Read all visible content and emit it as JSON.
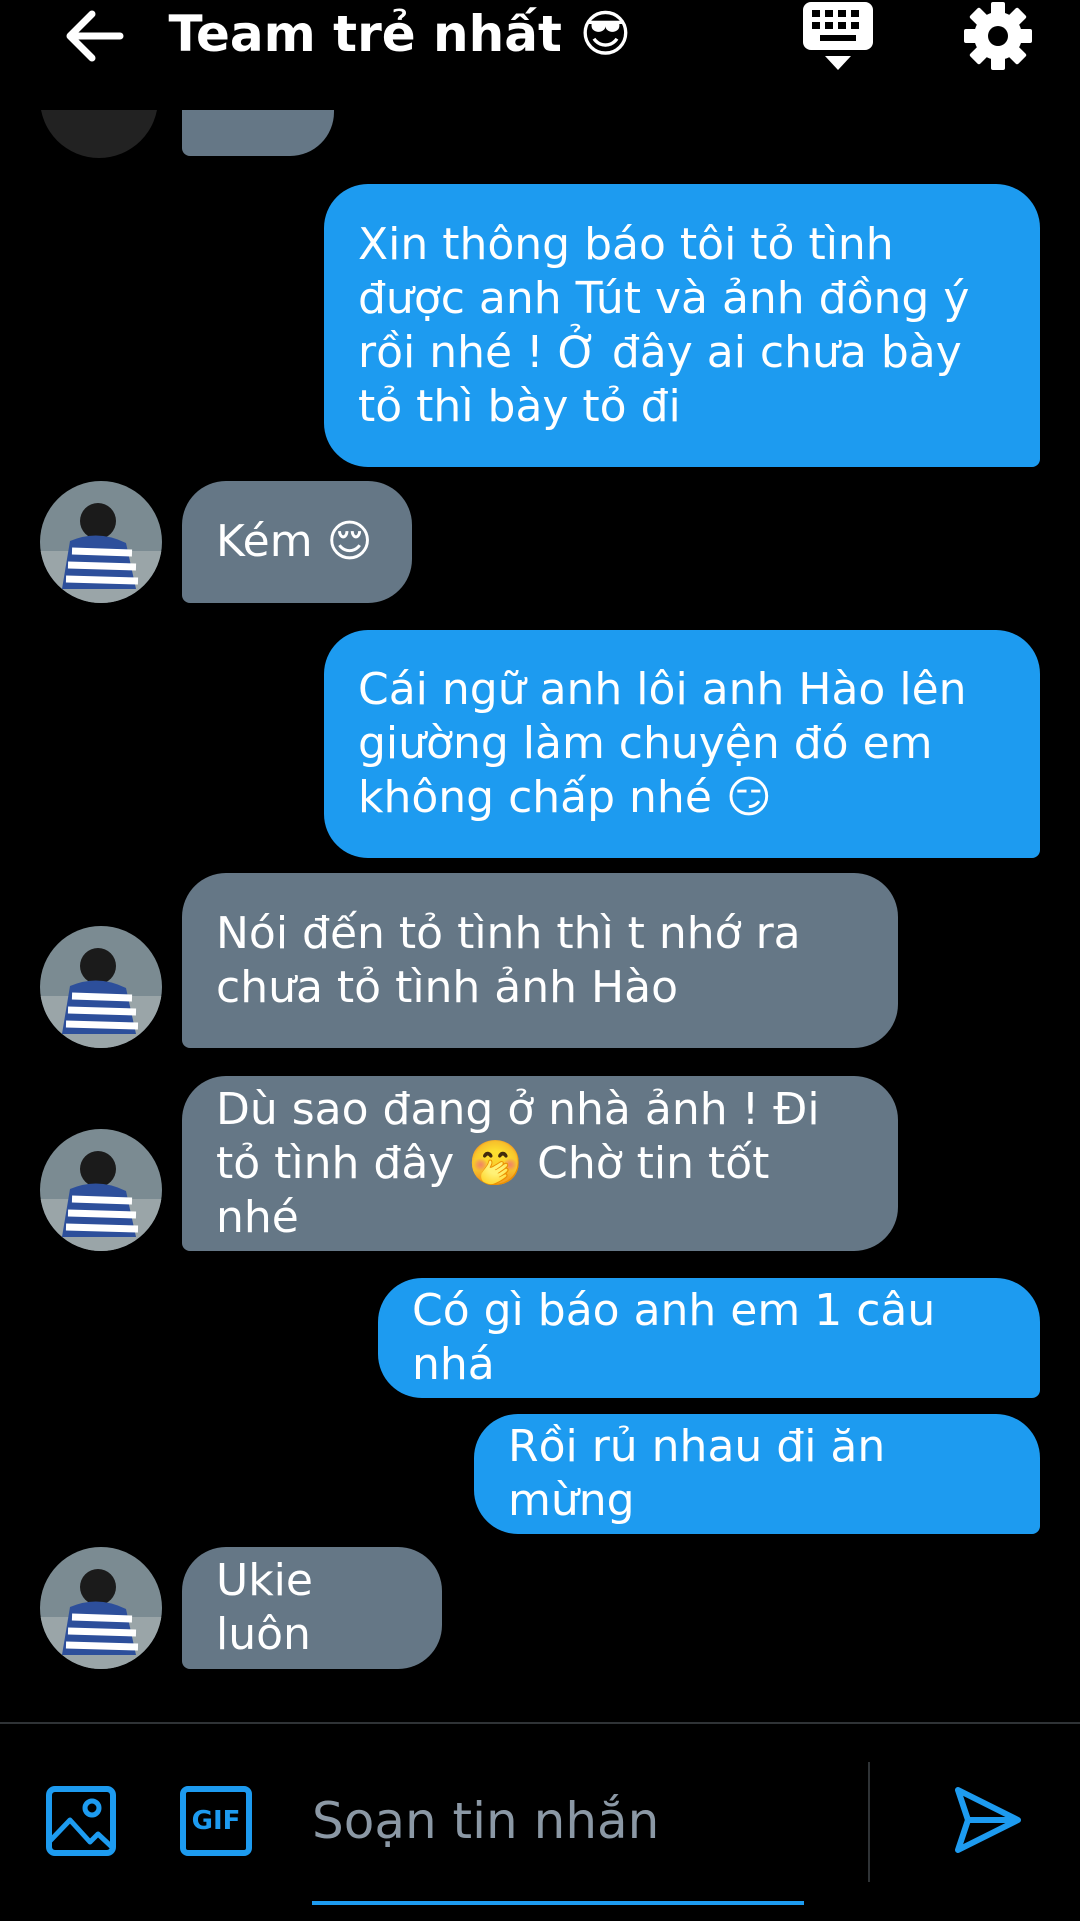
{
  "header": {
    "title": "Team trẻ nhất",
    "title_emoji": "😎",
    "back_icon": "arrow-left-icon",
    "keyboard_icon": "keyboard-icon",
    "settings_icon": "gear-icon"
  },
  "messages": [
    {
      "dir": "out",
      "text": "Xin thông báo tôi tỏ tình được anh Tút và ảnh đồng ý rồi nhé ! Ở đây ai chưa bày tỏ thì bày tỏ đi"
    },
    {
      "dir": "in",
      "text": "Kém",
      "emoji": "😌"
    },
    {
      "dir": "out",
      "text": "Cái ngữ anh lôi anh Hào lên giường làm chuyện đó em không chấp nhé",
      "emoji": "😏"
    },
    {
      "dir": "in",
      "text": "Nói đến tỏ tình thì t nhớ ra chưa tỏ tình ảnh Hào"
    },
    {
      "dir": "in",
      "text_a": "Dù sao đang ở nhà ảnh ! Đi tỏ tình đây",
      "emoji": "🤭",
      "text_b": "Chờ tin tốt nhé"
    },
    {
      "dir": "out",
      "text": "Có gì báo anh em 1 câu nhá"
    },
    {
      "dir": "out",
      "text": "Rồi rủ nhau đi ăn mừng"
    },
    {
      "dir": "in",
      "text": "Ukie luôn"
    }
  ],
  "composer": {
    "placeholder": "Soạn tin nhắn",
    "image_icon": "image-icon",
    "gif_label": "GIF",
    "send_icon": "send-icon"
  },
  "colors": {
    "outgoing_bubble": "#1d9bf0",
    "incoming_bubble": "#657786",
    "background": "#000000",
    "accent": "#1d9bf0"
  }
}
